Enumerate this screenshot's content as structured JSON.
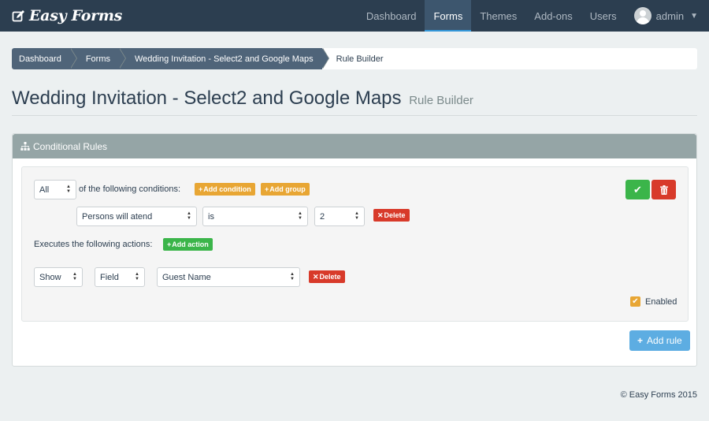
{
  "brand": {
    "name": "Easy Forms",
    "icon": "edit-icon"
  },
  "nav": {
    "items": [
      {
        "label": "Dashboard",
        "active": false
      },
      {
        "label": "Forms",
        "active": true
      },
      {
        "label": "Themes",
        "active": false
      },
      {
        "label": "Add-ons",
        "active": false
      },
      {
        "label": "Users",
        "active": false
      }
    ],
    "user": {
      "name": "admin",
      "avatar": "user-avatar-icon",
      "caret": "caret-down-icon"
    }
  },
  "breadcrumb": {
    "items": [
      "Dashboard",
      "Forms",
      "Wedding Invitation - Select2 and Google Maps"
    ],
    "current": "Rule Builder"
  },
  "page": {
    "title": "Wedding Invitation - Select2 and Google Maps",
    "subtitle": "Rule Builder"
  },
  "panel": {
    "title": "Conditional Rules",
    "icon": "sitemap-icon",
    "rule": {
      "match": {
        "value": "All"
      },
      "conditions_text": "of the following conditions:",
      "add_condition": "Add condition",
      "add_group": "Add group",
      "condition": {
        "field": "Persons will atend",
        "operator": "is",
        "value": "2",
        "delete": "Delete"
      },
      "actions_text": "Executes the following actions:",
      "add_action": "Add action",
      "action": {
        "type": "Show",
        "target": "Field",
        "field": "Guest Name",
        "delete": "Delete"
      },
      "enabled": {
        "label": "Enabled",
        "checked": true
      },
      "save_icon": "check-icon",
      "remove_icon": "trash-icon"
    },
    "add_rule": "Add rule"
  },
  "footer": {
    "text": "© Easy Forms 2015"
  },
  "colors": {
    "navbar": "#2c3e50",
    "active_tab_border": "#3498db",
    "warning": "#e8a634",
    "success": "#3bb54a",
    "danger": "#d83a2a",
    "info": "#5dade2",
    "panel_heading": "#95a5a6"
  }
}
